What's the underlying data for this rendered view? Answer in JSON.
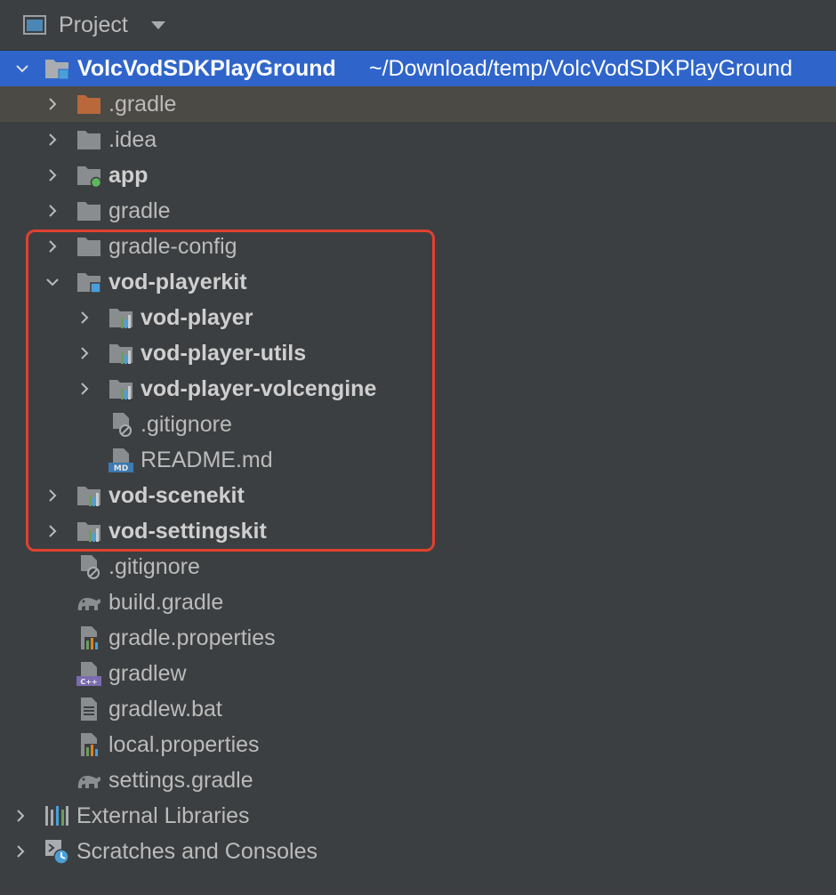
{
  "panel": {
    "title": "Project",
    "icon": "project-window-icon"
  },
  "root": {
    "name": "VolcVodSDKPlayGround",
    "path": "~/Download/temp/VolcVodSDKPlayGround",
    "icon": "module-folder-icon"
  },
  "items": [
    {
      "label": ".gradle",
      "icon": "folder-orange-icon"
    },
    {
      "label": ".idea",
      "icon": "folder-icon"
    },
    {
      "label": "app",
      "icon": "android-module-icon"
    },
    {
      "label": "gradle",
      "icon": "folder-icon"
    },
    {
      "label": "gradle-config",
      "icon": "folder-icon"
    },
    {
      "label": "vod-playerkit",
      "icon": "module-folder-icon"
    },
    {
      "label": "vod-player",
      "icon": "library-module-icon"
    },
    {
      "label": "vod-player-utils",
      "icon": "library-module-icon"
    },
    {
      "label": "vod-player-volcengine",
      "icon": "library-module-icon"
    },
    {
      "label": ".gitignore",
      "icon": "ignored-file-icon"
    },
    {
      "label": "README.md",
      "icon": "markdown-file-icon"
    },
    {
      "label": "vod-scenekit",
      "icon": "library-module-icon"
    },
    {
      "label": "vod-settingskit",
      "icon": "library-module-icon"
    },
    {
      "label": ".gitignore",
      "icon": "ignored-file-icon"
    },
    {
      "label": "build.gradle",
      "icon": "gradle-elephant-icon"
    },
    {
      "label": "gradle.properties",
      "icon": "properties-file-icon"
    },
    {
      "label": "gradlew",
      "icon": "cpp-file-icon"
    },
    {
      "label": "gradlew.bat",
      "icon": "text-file-icon"
    },
    {
      "label": "local.properties",
      "icon": "properties-file-icon"
    },
    {
      "label": "settings.gradle",
      "icon": "gradle-elephant-icon"
    },
    {
      "label": "External Libraries",
      "icon": "libraries-icon"
    },
    {
      "label": "Scratches and Consoles",
      "icon": "scratches-icon"
    }
  ],
  "icon_badges": {
    "md": "MD",
    "cpp": "C++"
  },
  "colors": {
    "background": "#3c3f41",
    "selection": "#2f65ca",
    "highlight_border": "#e0412f",
    "folder": "#8a8d90",
    "orange_folder": "#b8683a"
  }
}
